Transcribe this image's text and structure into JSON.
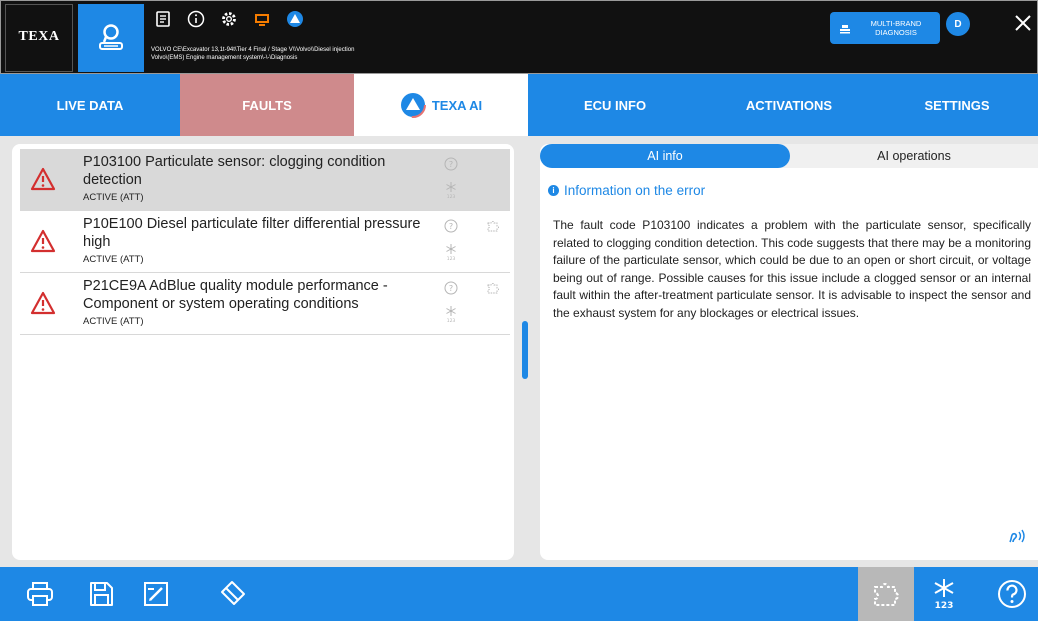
{
  "header": {
    "logo_text": "TEXA",
    "vehicle_path_line1": "VOLVO CE\\Excavator 13,1t-94t\\Tier 4 Final / Stage V\\\\Volvo\\\\Diesel injection",
    "vehicle_path_line2": "Volvo\\(EMS) Engine management system\\-\\-\\Diagnosis",
    "multibrand_line1": "MULTI-BRAND",
    "multibrand_line2": "DIAGNOSIS",
    "user_initial": "D"
  },
  "tabs": [
    {
      "label": "LIVE DATA"
    },
    {
      "label": "FAULTS"
    },
    {
      "label": "TEXA AI"
    },
    {
      "label": "ECU INFO"
    },
    {
      "label": "ACTIVATIONS"
    },
    {
      "label": "SETTINGS"
    }
  ],
  "faults": [
    {
      "title": "P103100 Particulate sensor: clogging condition detection",
      "status": "ACTIVE (ATT)",
      "selected": true
    },
    {
      "title": "P10E100 Diesel particulate filter differential pressure high",
      "status": "ACTIVE (ATT)",
      "selected": false
    },
    {
      "title": "P21CE9A AdBlue quality module performance - Component or system operating conditions",
      "status": "ACTIVE (ATT)",
      "selected": false
    }
  ],
  "ai_panel": {
    "seg_info": "AI info",
    "seg_operations": "AI operations",
    "info_title": "Information on the error",
    "info_body": "The fault code P103100 indicates a problem with the particulate sensor, specifically related to clogging condition detection. This code suggests that there may be a monitoring failure of the particulate sensor, which could be due to an open or short circuit, or voltage being out of range. Possible causes for this issue include a clogged sensor or an internal fault within the after-treatment particulate sensor. It is advisable to inspect the sensor and the exhaust system for any blockages or electrical issues."
  },
  "icons": {
    "home": "person-car-icon",
    "toolbar": [
      "document-icon",
      "info-icon",
      "settings-icon",
      "screen-icon",
      "texa-ai-icon"
    ],
    "bottom_left": [
      "print-icon",
      "save-icon",
      "report-edit-icon",
      "eraser-icon"
    ],
    "bottom_right": [
      "puzzle-icon",
      "freeze-frame-icon",
      "help-icon"
    ]
  },
  "colors": {
    "accent": "#1e88e5",
    "faults_tab": "#cf8a8c",
    "warning": "#d32f2f",
    "screen_icon": "#f57c00"
  }
}
